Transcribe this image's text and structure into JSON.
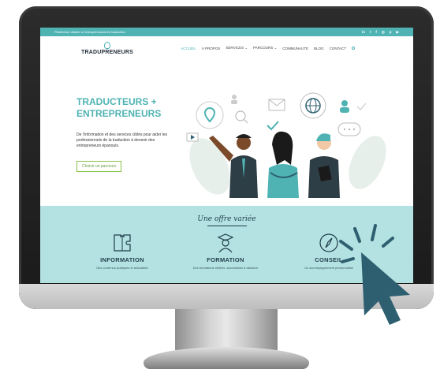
{
  "topbar": {
    "text": "Plateforme dédiée à l'entrepreneuriat en traduction",
    "social_icons": [
      "in",
      "t",
      "f",
      "◎",
      "p",
      "▶"
    ]
  },
  "nav": {
    "logo_text": "TRADUPRENEURS",
    "menu": [
      "ACCUEIL",
      "À PROPOS",
      "SERVICES ⌄",
      "PARCOURS ⌄",
      "COMMUNAUTÉ",
      "BLOG",
      "CONTACT"
    ]
  },
  "hero": {
    "title_line1": "TRADUCTEURS +",
    "title_line2": "ENTREPRENEURS",
    "description": "De l'information et des services ciblés pour aider les professionnels de la traduction à devenir des entrepreneurs épanouis.",
    "cta": "Choisir un parcours"
  },
  "offer": {
    "title": "Une offre variée",
    "items": [
      {
        "name": "INFORMATION",
        "sub": "Des contenus pratiques et actualisés",
        "icon": "puzzle-icon"
      },
      {
        "name": "FORMATION",
        "sub": "Des formations ciblées, accessibles à distance",
        "icon": "graduate-icon"
      },
      {
        "name": "CONSEIL",
        "sub": "Un accompagnement personnalisé",
        "icon": "compass-icon"
      }
    ]
  },
  "colors": {
    "accent": "#4fb3b3",
    "band": "#b4e2e2",
    "navy": "#1f3d4a",
    "cursor": "#2d5f70"
  }
}
